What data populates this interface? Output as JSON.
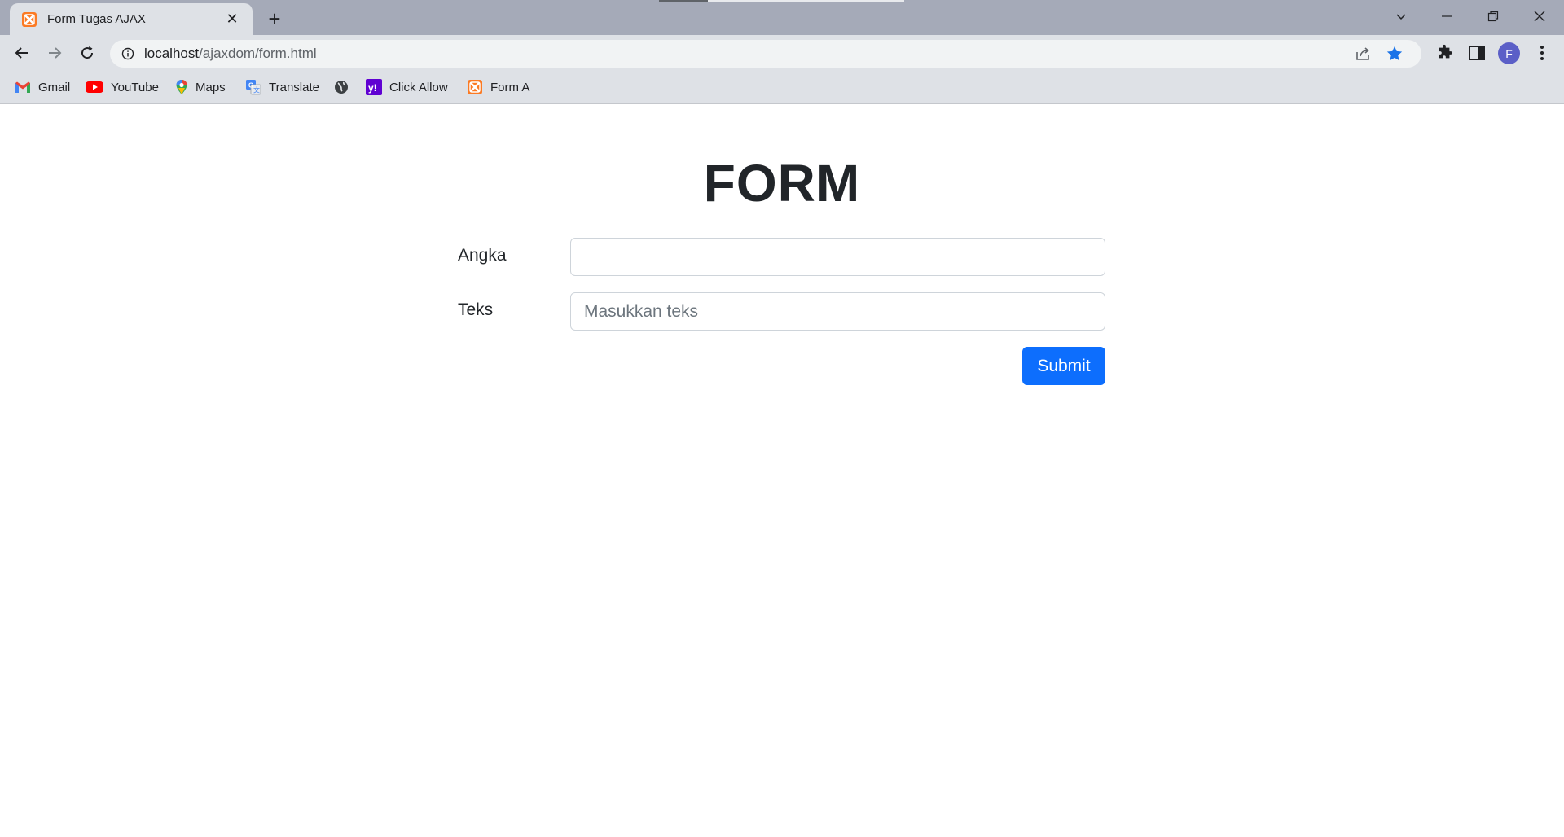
{
  "browser": {
    "tab_title": "Form Tugas AJAX",
    "url_host": "localhost",
    "url_path": "/ajaxdom/form.html",
    "profile_initial": "F",
    "accent_star_color": "#1a73e8"
  },
  "bookmarks": [
    {
      "label": "Gmail",
      "icon": "gmail-icon"
    },
    {
      "label": "YouTube",
      "icon": "youtube-icon"
    },
    {
      "label": "Maps",
      "icon": "maps-icon"
    },
    {
      "label": "Translate",
      "icon": "translate-icon"
    },
    {
      "label": "",
      "icon": "globe-icon"
    },
    {
      "label": "Click Allow",
      "icon": "yahoo-icon"
    },
    {
      "label": "Form A",
      "icon": "xampp-icon"
    }
  ],
  "form": {
    "title": "FORM",
    "angka_label": "Angka",
    "angka_value": "",
    "teks_label": "Teks",
    "teks_placeholder": "Masukkan teks",
    "submit_label": "Submit",
    "button_color": "#0d6efd"
  }
}
